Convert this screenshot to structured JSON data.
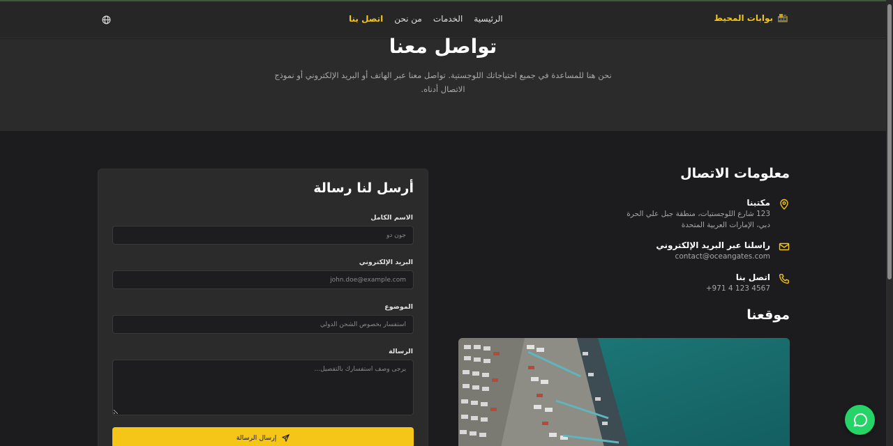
{
  "header": {
    "brand": "بوابات المحيط",
    "nav": [
      {
        "label": "الرئيسية",
        "active": false
      },
      {
        "label": "الخدمات",
        "active": false
      },
      {
        "label": "من نحن",
        "active": false
      },
      {
        "label": "اتصل بنا",
        "active": true
      }
    ],
    "language_icon": "globe-icon"
  },
  "hero": {
    "title": "تواصل معنا",
    "subtitle": "نحن هنا للمساعدة في جميع احتياجاتك اللوجستية. تواصل معنا عبر الهاتف أو البريد الإلكتروني أو نموذج الاتصال أدناه."
  },
  "contact_info": {
    "title": "معلومات الاتصال",
    "office": {
      "heading": "مكتبنا",
      "line1": "123 شارع اللوجستيات، منطقة جبل علي الحرة",
      "line2": "دبي، الإمارات العربية المتحدة",
      "icon": "map-pin-icon"
    },
    "email": {
      "heading": "راسلنا عبر البريد الإلكتروني",
      "value": "contact@oceangates.com",
      "icon": "mail-icon"
    },
    "phone": {
      "heading": "اتصل بنا",
      "value": "+971 4 123 4567",
      "icon": "phone-icon"
    }
  },
  "location": {
    "title": "موقعنا"
  },
  "form": {
    "title": "أرسل لنا رسالة",
    "name_label": "الاسم الكامل",
    "name_placeholder": "جون دو",
    "email_label": "البريد الإلكتروني",
    "email_placeholder": "john.doe@example.com",
    "subject_label": "الموضوع",
    "subject_placeholder": "استفسار بخصوص الشحن الدولي",
    "message_label": "الرسالة",
    "message_placeholder": "يرجى وصف استفسارك بالتفصيل...",
    "submit_label": "إرسال الرسالة"
  },
  "colors": {
    "accent": "#f5c518",
    "background": "#1c1c1e",
    "whatsapp": "#25d366"
  }
}
